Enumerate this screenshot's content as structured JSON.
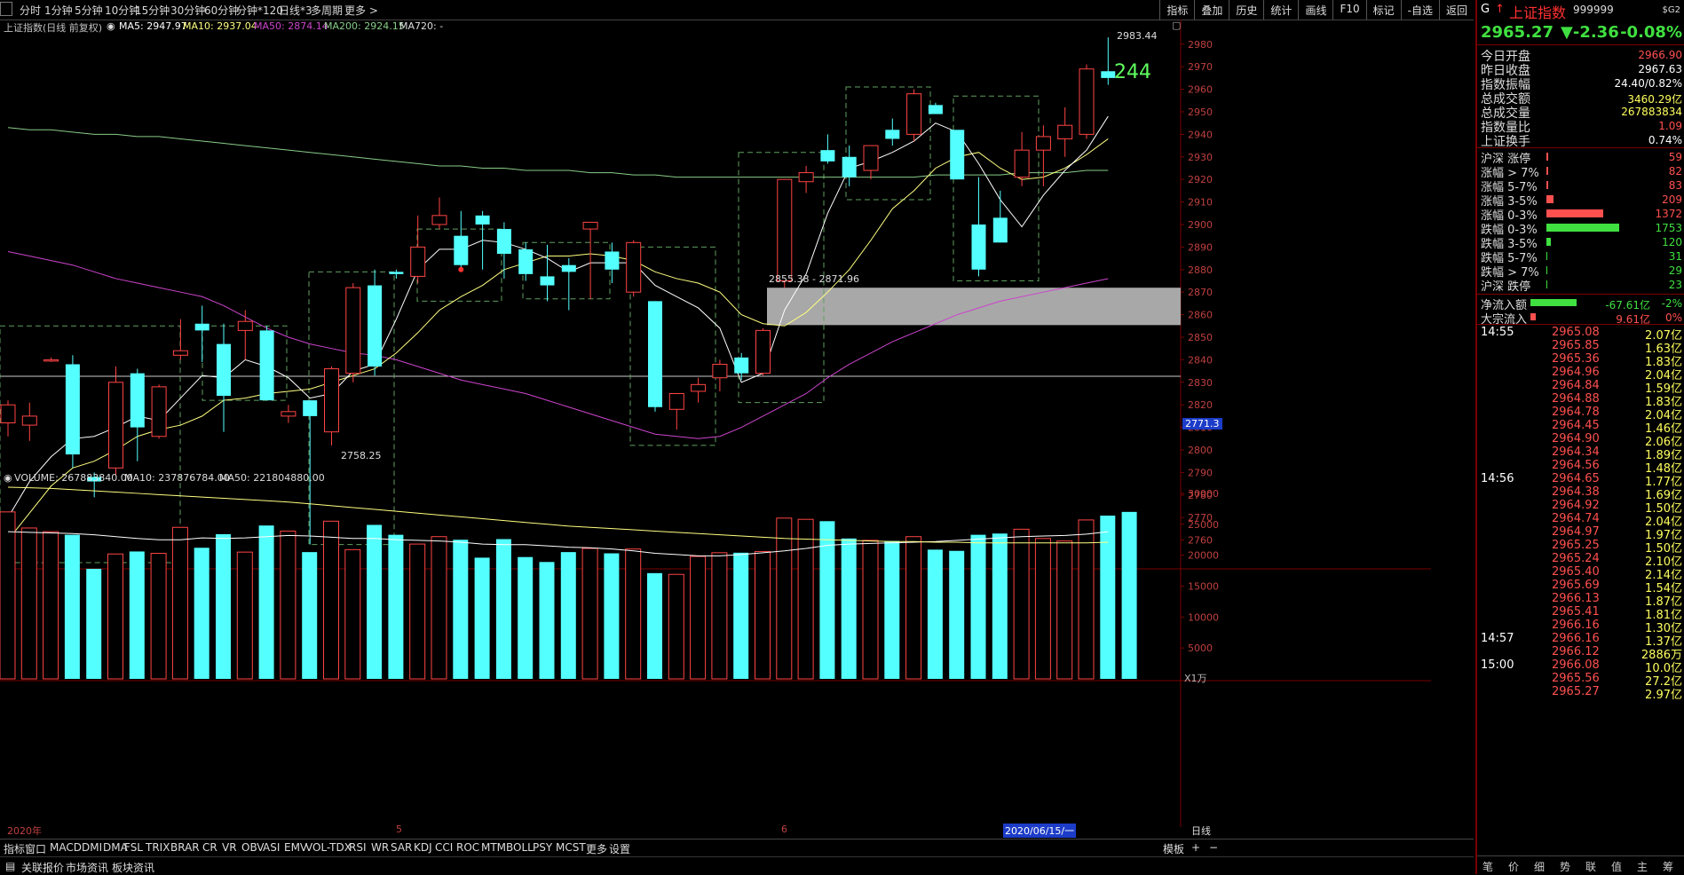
{
  "toolbar": {
    "period_tabs": [
      "分时",
      "1分钟",
      "5分钟",
      "10分钟",
      "15分钟",
      "30分钟",
      "60分钟",
      "分钟*120",
      "日线*3",
      "多周期",
      "更多 >"
    ],
    "right_buttons": [
      "指标",
      "叠加",
      "历史",
      "统计",
      "画线",
      "F10",
      "标记",
      "-自选",
      "返回"
    ]
  },
  "kline_header": {
    "title": "上证指数(日线 前复权)",
    "ma5": "MA5: 2947.97",
    "ma10": "MA10: 2937.04",
    "ma50": "MA50: 2874.14",
    "ma200": "MA200: 2924.15",
    "ma720": "MA720: -"
  },
  "vol_header": {
    "volume": "VOLUME: 267883840.00",
    "ma10": "MA10: 237876784.00",
    "ma50": "MA50: 221804880.00"
  },
  "annotations": {
    "high_label": "2983.44",
    "count_label": "244",
    "low_label": "2758.25",
    "zone_label": "2855.38 - 2871.96",
    "cursor_price": "2771.3",
    "date_2020": "2020年",
    "month5": "5",
    "month6": "6",
    "cursor_date": "2020/06/15/一",
    "vol_unit": "X1万",
    "period_label": "日线"
  },
  "price_axis": [
    "2980",
    "2970",
    "2960",
    "2950",
    "2940",
    "2930",
    "2920",
    "2910",
    "2900",
    "2890",
    "2880",
    "2870",
    "2860",
    "2850",
    "2840",
    "2830",
    "2820",
    "2810",
    "2800",
    "2790",
    "2780",
    "2770",
    "2760"
  ],
  "vol_axis": [
    "30000",
    "25000",
    "20000",
    "15000",
    "10000",
    "5000"
  ],
  "chart_data": {
    "type": "candlestick",
    "ohlc": [
      [
        2812,
        2822,
        2806,
        2820
      ],
      [
        2811,
        2821,
        2804,
        2815
      ],
      [
        2840,
        2841,
        2839,
        2840
      ],
      [
        2838,
        2842,
        2792,
        2798
      ],
      [
        2788,
        2790,
        2779,
        2786
      ],
      [
        2792,
        2837,
        2789,
        2830
      ],
      [
        2834,
        2836,
        2795,
        2810
      ],
      [
        2806,
        2829,
        2805,
        2828
      ],
      [
        2842,
        2858,
        2840,
        2844
      ],
      [
        2856,
        2864,
        2839,
        2853
      ],
      [
        2847,
        2856,
        2808,
        2824
      ],
      [
        2853,
        2862,
        2840,
        2857
      ],
      [
        2853,
        2855,
        2822,
        2822
      ],
      [
        2815,
        2820,
        2812,
        2817
      ],
      [
        2822,
        2822,
        2758,
        2815
      ],
      [
        2808,
        2837,
        2802,
        2836
      ],
      [
        2834,
        2874,
        2830,
        2872
      ],
      [
        2873,
        2880,
        2833,
        2837
      ],
      [
        2879,
        2880,
        2876,
        2878
      ],
      [
        2877,
        2904,
        2874,
        2890
      ],
      [
        2900,
        2912,
        2898,
        2904
      ],
      [
        2895,
        2906,
        2880,
        2882
      ],
      [
        2904,
        2906,
        2880,
        2900
      ],
      [
        2898,
        2901,
        2876,
        2887
      ],
      [
        2889,
        2892,
        2875,
        2878
      ],
      [
        2877,
        2891,
        2866,
        2873
      ],
      [
        2882,
        2885,
        2862,
        2879
      ],
      [
        2898,
        2901,
        2867,
        2901
      ],
      [
        2888,
        2892,
        2874,
        2880
      ],
      [
        2870,
        2893,
        2868,
        2892
      ],
      [
        2866,
        2866,
        2817,
        2819
      ],
      [
        2818,
        2823,
        2809,
        2825
      ],
      [
        2826,
        2832,
        2821,
        2829
      ],
      [
        2832,
        2840,
        2826,
        2838
      ],
      [
        2841,
        2843,
        2831,
        2834
      ],
      [
        2834,
        2854,
        2833,
        2853
      ],
      [
        2875,
        2919,
        2872,
        2920
      ],
      [
        2919,
        2926,
        2914,
        2923
      ],
      [
        2933,
        2940,
        2927,
        2928
      ],
      [
        2930,
        2935,
        2917,
        2921
      ],
      [
        2924,
        2933,
        2920,
        2935
      ],
      [
        2942,
        2947,
        2935,
        2938
      ],
      [
        2940,
        2960,
        2937,
        2958
      ],
      [
        2953,
        2954,
        2949,
        2949
      ],
      [
        2942,
        2941,
        2920,
        2920
      ],
      [
        2900,
        2921,
        2877,
        2880
      ],
      [
        2903,
        2915,
        2892,
        2892
      ],
      [
        2921,
        2941,
        2917,
        2933
      ],
      [
        2933,
        2944,
        2917,
        2939
      ],
      [
        2938,
        2952,
        2930,
        2944
      ],
      [
        2940,
        2971,
        2938,
        2969
      ],
      [
        2968,
        2983,
        2962,
        2965
      ]
    ],
    "ma5": [
      2770,
      2786,
      2797,
      2805,
      2806,
      2810,
      2815,
      2813,
      2823,
      2833,
      2832,
      2840,
      2837,
      2832,
      2823,
      2825,
      2835,
      2838,
      2858,
      2880,
      2889,
      2889,
      2893,
      2892,
      2889,
      2885,
      2879,
      2883,
      2883,
      2883,
      2873,
      2868,
      2863,
      2854,
      2830,
      2834,
      2862,
      2878,
      2905,
      2925,
      2928,
      2932,
      2937,
      2945,
      2941,
      2927,
      2911,
      2899,
      2913,
      2924,
      2933,
      2948
    ],
    "ma10": [
      2760,
      2772,
      2784,
      2792,
      2795,
      2800,
      2806,
      2809,
      2811,
      2815,
      2822,
      2823,
      2825,
      2826,
      2827,
      2830,
      2833,
      2836,
      2843,
      2852,
      2862,
      2868,
      2873,
      2880,
      2883,
      2886,
      2886,
      2887,
      2886,
      2884,
      2879,
      2876,
      2874,
      2870,
      2860,
      2856,
      2855,
      2861,
      2870,
      2880,
      2893,
      2907,
      2915,
      2925,
      2930,
      2932,
      2925,
      2920,
      2921,
      2925,
      2931,
      2938
    ],
    "ma50": [
      2888,
      2886,
      2884,
      2882,
      2879,
      2876,
      2874,
      2872,
      2870,
      2868,
      2864,
      2859,
      2854,
      2850,
      2847,
      2845,
      2843,
      2842,
      2840,
      2837,
      2834,
      2831,
      2829,
      2827,
      2825,
      2822,
      2819,
      2816,
      2813,
      2810,
      2807,
      2806,
      2805,
      2806,
      2810,
      2815,
      2820,
      2825,
      2832,
      2838,
      2843,
      2848,
      2852,
      2856,
      2860,
      2863,
      2866,
      2868,
      2870,
      2872,
      2874,
      2876
    ],
    "ma200": [
      2943,
      2942,
      2942,
      2941,
      2940,
      2940,
      2939,
      2939,
      2938,
      2937,
      2936,
      2935,
      2934,
      2933,
      2932,
      2931,
      2930,
      2929,
      2928,
      2927,
      2926,
      2926,
      2925,
      2925,
      2924,
      2924,
      2924,
      2923,
      2923,
      2922,
      2922,
      2921,
      2921,
      2921,
      2921,
      2921,
      2921,
      2921,
      2921,
      2921,
      2921,
      2921,
      2921,
      2922,
      2922,
      2922,
      2922,
      2923,
      2923,
      2923,
      2924,
      2924
    ],
    "volume": [
      27000,
      24400,
      23800,
      23300,
      17800,
      20200,
      20600,
      20300,
      24500,
      21200,
      23400,
      20500,
      24800,
      23900,
      20500,
      25500,
      20900,
      24900,
      23300,
      21800,
      23000,
      22500,
      19600,
      22600,
      19700,
      18900,
      20500,
      21100,
      20300,
      21000,
      17100,
      16900,
      19800,
      20400,
      20400,
      20600,
      26000,
      25800,
      25500,
      22700,
      22400,
      22300,
      23000,
      20900,
      20700,
      23300,
      23500,
      24200,
      22700,
      22300,
      25700,
      26400,
      27000
    ],
    "vol_ma10": [
      23800,
      23700,
      23600,
      23500,
      23300,
      23000,
      22700,
      22500,
      22500,
      22800,
      22700,
      22800,
      23000,
      23200,
      23100,
      22900,
      22700,
      22700,
      22500,
      22400,
      22300,
      22100,
      21800,
      21700,
      21700,
      21500,
      21300,
      21200,
      21000,
      20700,
      20300,
      20100,
      19900,
      19900,
      20100,
      20400,
      20700,
      21100,
      21600,
      21800,
      21900,
      22000,
      22100,
      22200,
      22400,
      22600,
      22800,
      23000,
      23100,
      23200,
      23400,
      23800
    ],
    "vol_ma50": [
      31000,
      30900,
      30800,
      30600,
      30400,
      30200,
      30000,
      29800,
      29600,
      29400,
      29200,
      29000,
      28800,
      28600,
      28300,
      28000,
      27700,
      27400,
      27100,
      26800,
      26500,
      26200,
      25900,
      25600,
      25300,
      25000,
      24700,
      24500,
      24300,
      24100,
      23900,
      23700,
      23500,
      23300,
      23100,
      22900,
      22700,
      22600,
      22500,
      22400,
      22300,
      22200,
      22200,
      22100,
      22100,
      22000,
      22000,
      22000,
      22000,
      22000,
      22000,
      22100
    ],
    "ylim_price": [
      2750,
      2987
    ],
    "ylim_volume": [
      0,
      32000
    ]
  },
  "quote": {
    "flag": "G",
    "name": "上证指数",
    "code": "999999",
    "badge": "$G2",
    "price": "2965.27",
    "change": "▼-2.36",
    "pct": "-0.08%",
    "rows": [
      {
        "k": "今日开盘",
        "v": "2966.90",
        "c": "#ff5050"
      },
      {
        "k": "昨日收盘",
        "v": "2967.63",
        "c": "#ffffff"
      },
      {
        "k": "指数振幅",
        "v": "24.40/0.82%",
        "c": "#ffffff"
      },
      {
        "k": "总成交额",
        "v": "3460.29亿",
        "c": "#ffff60"
      },
      {
        "k": "总成交量",
        "v": "267883834",
        "c": "#ffff60"
      },
      {
        "k": "指数量比",
        "v": "1.09",
        "c": "#ff5050"
      },
      {
        "k": "上证换手",
        "v": "0.74%",
        "c": "#ffffff"
      }
    ],
    "breadth": [
      {
        "k": "沪深 涨停",
        "v": "59",
        "w": 2,
        "c": "#ff5050"
      },
      {
        "k": "涨幅 > 7%",
        "v": "82",
        "w": 2,
        "c": "#ff5050"
      },
      {
        "k": "涨幅 5-7%",
        "v": "83",
        "w": 2,
        "c": "#ff5050"
      },
      {
        "k": "涨幅 3-5%",
        "v": "209",
        "w": 8,
        "c": "#ff5050"
      },
      {
        "k": "涨幅 0-3%",
        "v": "1372",
        "w": 64,
        "c": "#ff5050"
      },
      {
        "k": "跌幅 0-3%",
        "v": "1753",
        "w": 82,
        "c": "#40e040"
      },
      {
        "k": "跌幅 3-5%",
        "v": "120",
        "w": 5,
        "c": "#40e040"
      },
      {
        "k": "跌幅 5-7%",
        "v": "31",
        "w": 1,
        "c": "#40e040"
      },
      {
        "k": "跌幅 > 7%",
        "v": "29",
        "w": 1,
        "c": "#40e040"
      },
      {
        "k": "沪深 跌停",
        "v": "23",
        "w": 1,
        "c": "#40e040"
      }
    ],
    "flow": [
      {
        "k": "净流入额",
        "v": "-67.61亿",
        "p": "-2%",
        "w": 52,
        "c": "#40e040"
      },
      {
        "k": "大宗流入",
        "v": "9.61亿",
        "p": "0%",
        "w": 6,
        "c": "#ff5050"
      }
    ],
    "ticks": [
      {
        "t": "14:55",
        "p": "2965.08",
        "a": "2.07亿"
      },
      {
        "t": "",
        "p": "2965.85",
        "a": "1.63亿"
      },
      {
        "t": "",
        "p": "2965.36",
        "a": "1.83亿"
      },
      {
        "t": "",
        "p": "2964.96",
        "a": "2.04亿"
      },
      {
        "t": "",
        "p": "2964.84",
        "a": "1.59亿"
      },
      {
        "t": "",
        "p": "2964.88",
        "a": "1.83亿"
      },
      {
        "t": "",
        "p": "2964.78",
        "a": "2.04亿"
      },
      {
        "t": "",
        "p": "2964.45",
        "a": "1.46亿"
      },
      {
        "t": "",
        "p": "2964.90",
        "a": "2.06亿"
      },
      {
        "t": "",
        "p": "2964.34",
        "a": "1.89亿"
      },
      {
        "t": "",
        "p": "2964.56",
        "a": "1.48亿"
      },
      {
        "t": "14:56",
        "p": "2964.65",
        "a": "1.77亿"
      },
      {
        "t": "",
        "p": "2964.38",
        "a": "1.69亿"
      },
      {
        "t": "",
        "p": "2964.92",
        "a": "1.50亿"
      },
      {
        "t": "",
        "p": "2964.74",
        "a": "2.04亿"
      },
      {
        "t": "",
        "p": "2964.97",
        "a": "1.97亿"
      },
      {
        "t": "",
        "p": "2965.25",
        "a": "1.50亿"
      },
      {
        "t": "",
        "p": "2965.24",
        "a": "2.10亿"
      },
      {
        "t": "",
        "p": "2965.40",
        "a": "2.14亿"
      },
      {
        "t": "",
        "p": "2965.69",
        "a": "1.54亿"
      },
      {
        "t": "",
        "p": "2966.13",
        "a": "1.87亿"
      },
      {
        "t": "",
        "p": "2965.41",
        "a": "1.81亿"
      },
      {
        "t": "",
        "p": "2966.16",
        "a": "1.30亿"
      },
      {
        "t": "14:57",
        "p": "2966.16",
        "a": "1.37亿"
      },
      {
        "t": "",
        "p": "2966.12",
        "a": "2886万"
      },
      {
        "t": "15:00",
        "p": "2966.08",
        "a": "10.0亿"
      },
      {
        "t": "",
        "p": "2965.56",
        "a": "27.2亿"
      },
      {
        "t": "",
        "p": "2965.27",
        "a": "2.97亿"
      }
    ],
    "bottom_tabs": [
      "笔",
      "价",
      "细",
      "势",
      "联",
      "值",
      "主",
      "筹"
    ]
  },
  "indicator_tabs": [
    "指标",
    "窗口",
    "MACD",
    "DMI",
    "DMA",
    "FSL",
    "TRIX",
    "BRAR",
    "CR",
    "VR",
    "OBV",
    "ASI",
    "EMV",
    "VOL-TDX",
    "RSI",
    "WR",
    "SAR",
    "KDJ",
    "CCI",
    "ROC",
    "MTM",
    "BOLL",
    "PSY",
    "MCST",
    "更多",
    "设置"
  ],
  "indicator_right": [
    "模板",
    "+",
    "−"
  ],
  "status": [
    "关联报价",
    "市场资讯",
    "板块资讯"
  ],
  "colors": {
    "up": "#ff4444",
    "down": "#54ffff",
    "ma5": "#ffffff",
    "ma10": "#ffff80",
    "ma50": "#cc44cc",
    "ma200": "#88cc88"
  }
}
